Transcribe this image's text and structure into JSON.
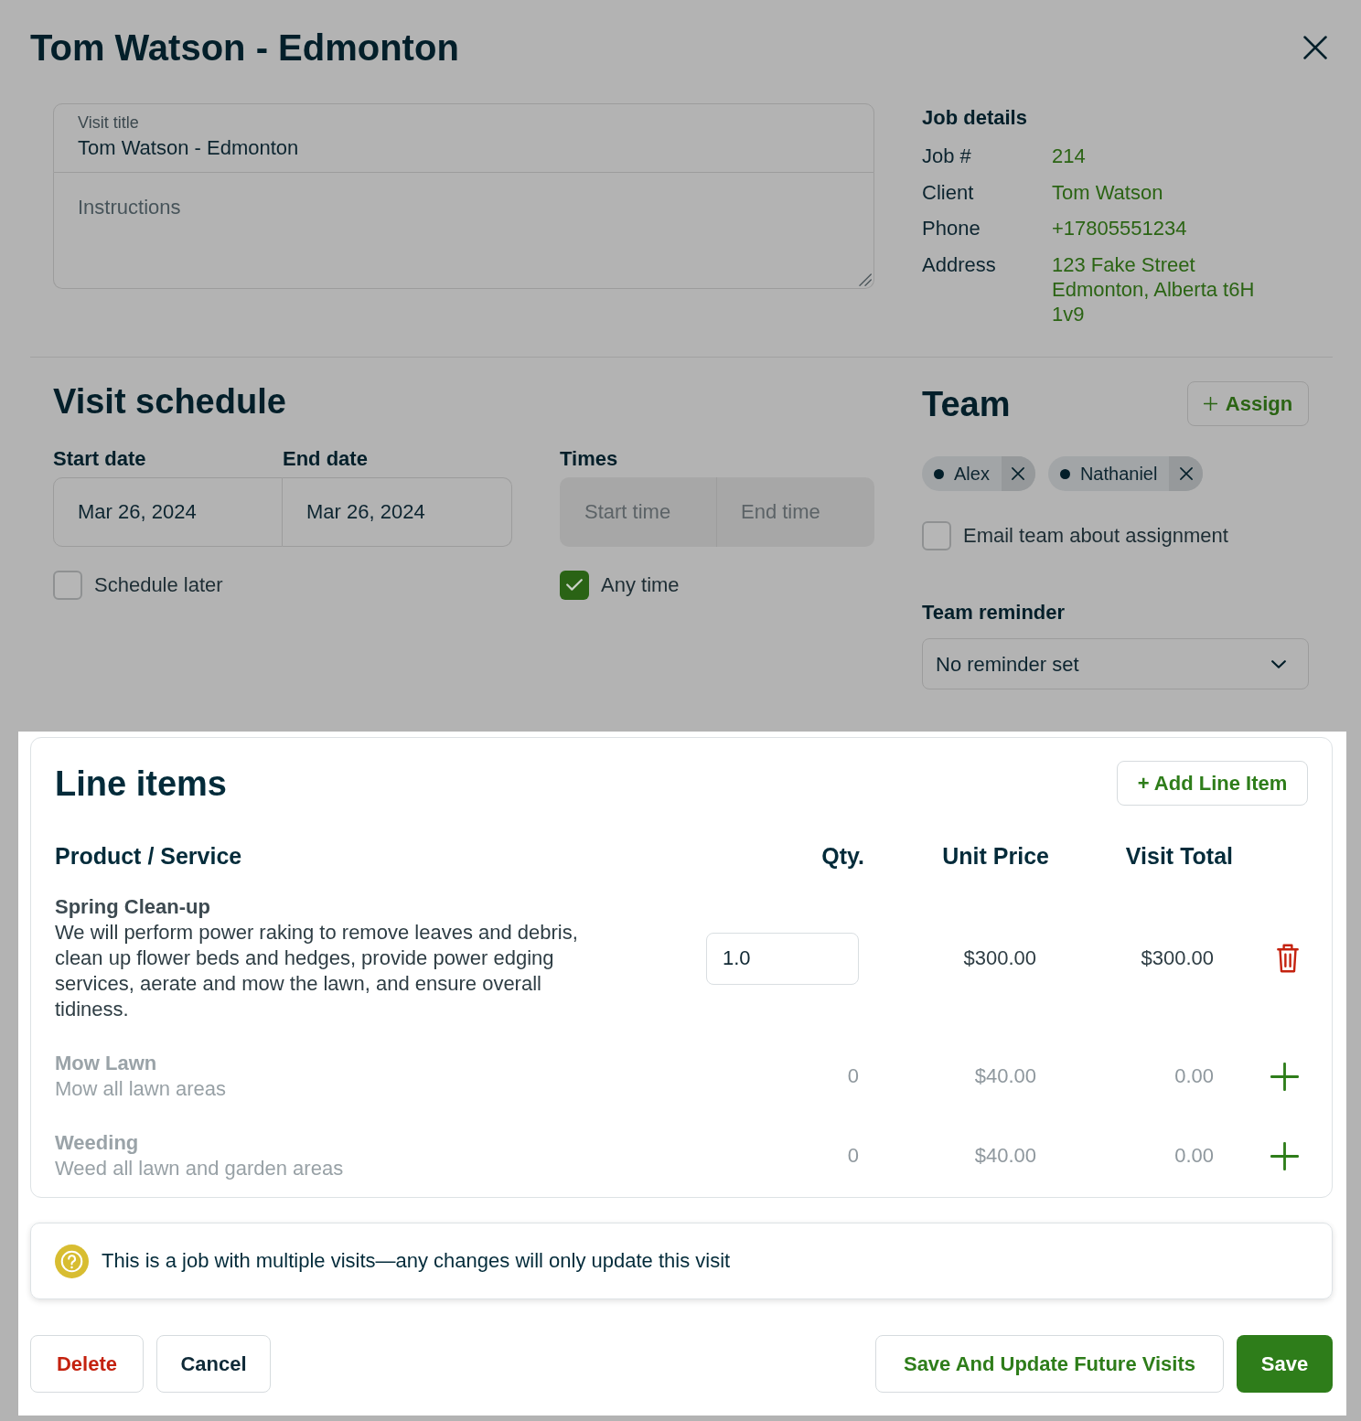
{
  "dialog": {
    "title": "Tom Watson - Edmonton"
  },
  "visit": {
    "title_field": {
      "label": "Visit title",
      "value": "Tom Watson - Edmonton"
    },
    "instructions": {
      "placeholder": "Instructions"
    }
  },
  "job_details": {
    "heading": "Job details",
    "rows": [
      {
        "label": "Job #",
        "lines": [
          "214"
        ]
      },
      {
        "label": "Client",
        "lines": [
          "Tom Watson"
        ]
      },
      {
        "label": "Phone",
        "lines": [
          "+17805551234"
        ]
      },
      {
        "label": "Address",
        "lines": [
          "123 Fake Street",
          "Edmonton, Alberta t6H",
          "1v9"
        ]
      }
    ]
  },
  "schedule": {
    "heading": "Visit schedule",
    "start_date": {
      "label": "Start date",
      "value": "Mar 26, 2024"
    },
    "end_date": {
      "label": "End date",
      "value": "Mar 26, 2024"
    },
    "times": {
      "label": "Times",
      "start_placeholder": "Start time",
      "end_placeholder": "End time",
      "disabled": true
    },
    "schedule_later": {
      "label": "Schedule later",
      "checked": false
    },
    "any_time": {
      "label": "Any time",
      "checked": true
    }
  },
  "team": {
    "heading": "Team",
    "assign_button": "Assign",
    "members": [
      {
        "name": "Alex"
      },
      {
        "name": "Nathaniel"
      }
    ],
    "email_team": {
      "label": "Email team about assignment",
      "checked": false
    },
    "reminder": {
      "label": "Team reminder",
      "value": "No reminder set"
    }
  },
  "line_items": {
    "heading": "Line items",
    "add_button": "+ Add Line Item",
    "columns": [
      "Product / Service",
      "Qty.",
      "Unit Price",
      "Visit Total"
    ],
    "rows": [
      {
        "kind": "added",
        "name": "Spring Clean-up",
        "description": "We will perform power raking to remove leaves and debris, clean up flower beds and hedges, provide power edging services, aerate and mow the lawn, and ensure overall tidiness.",
        "qty": "1.0",
        "unit_price": "$300.00",
        "total": "$300.00"
      },
      {
        "kind": "suggested",
        "name": "Mow Lawn",
        "description": "Mow all lawn areas",
        "qty": "0",
        "unit_price": "$40.00",
        "total": "0.00"
      },
      {
        "kind": "suggested",
        "name": "Weeding",
        "description": "Weed all lawn and garden areas",
        "qty": "0",
        "unit_price": "$40.00",
        "total": "0.00"
      }
    ]
  },
  "notice": {
    "text": "This is a job with multiple visits—any changes will only update this visit"
  },
  "footer": {
    "left": [
      {
        "label": "Delete",
        "kind": "danger"
      },
      {
        "label": "Cancel",
        "kind": "secondary"
      }
    ],
    "right": [
      {
        "label": "Save And Update Future Visits",
        "kind": "outline"
      },
      {
        "label": "Save",
        "kind": "primary"
      }
    ]
  }
}
